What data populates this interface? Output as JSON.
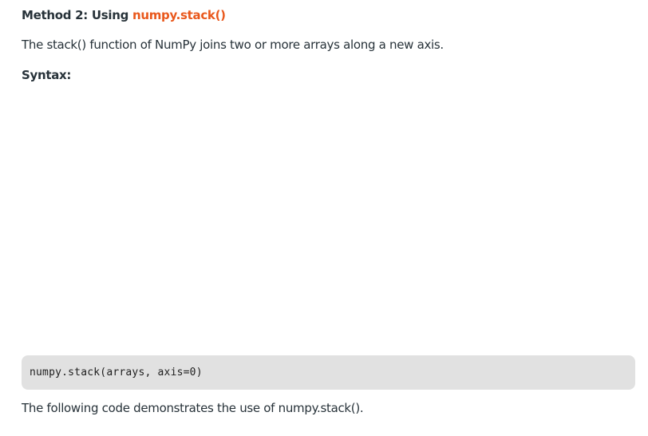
{
  "heading": {
    "prefix": "Method 2: Using ",
    "accent": "numpy.stack()"
  },
  "intro": "The stack() function of NumPy joins two or more arrays along a new axis.",
  "syntax_label": "Syntax:",
  "code": "numpy.stack(arrays, axis=0)",
  "follow_up": "The following code demonstrates the use of numpy.stack().",
  "colors": {
    "accent": "#e9581c",
    "text": "#273239",
    "code_background": "#e1e1e1"
  }
}
